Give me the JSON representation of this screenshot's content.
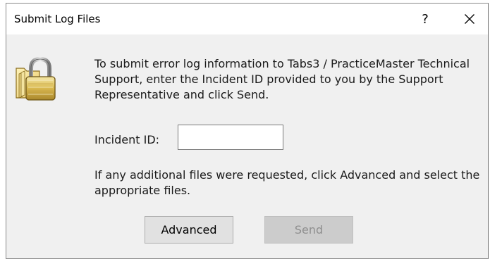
{
  "window": {
    "title": "Submit Log Files",
    "help_label": "?",
    "close_label": "✕"
  },
  "icons": {
    "dialog_icon": "folder-lock-icon"
  },
  "content": {
    "description": "To submit error log information to Tabs3 / PracticeMaster Technical Support, enter the Incident ID provided to you by the Support Representative and click Send.",
    "incident_label": "Incident ID:",
    "incident_value": "",
    "incident_placeholder": "",
    "additional_text": "If any additional files were requested, click Advanced and select the appropriate files."
  },
  "buttons": {
    "advanced_label": "Advanced",
    "send_label": "Send",
    "send_enabled": false
  },
  "colors": {
    "dialog_bg": "#f0f0f0",
    "titlebar_bg": "#ffffff",
    "button_bg": "#e1e1e1",
    "button_disabled_bg": "#cccccc",
    "button_disabled_text": "#8f8f8f"
  }
}
